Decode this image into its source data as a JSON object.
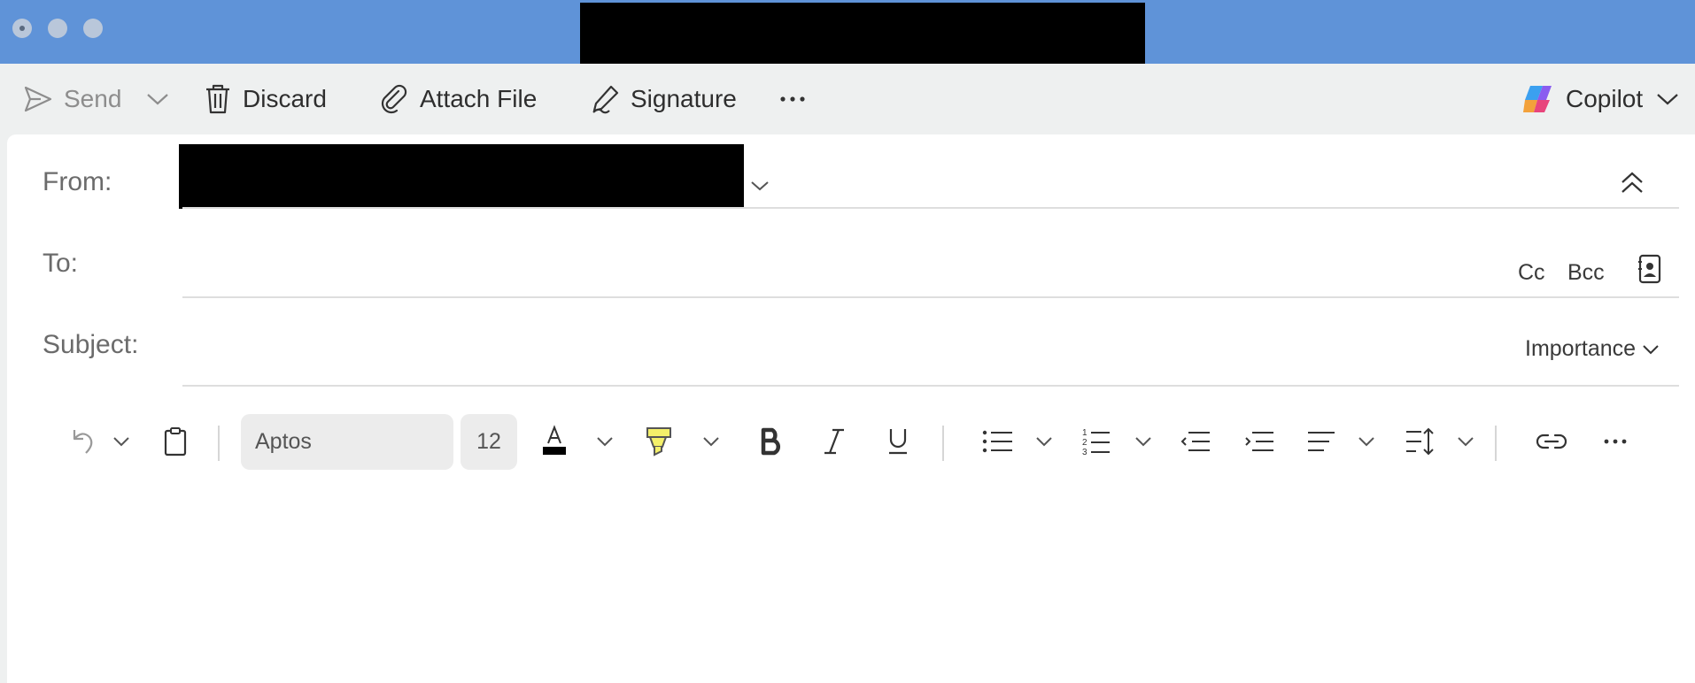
{
  "titlebar": {
    "controls": [
      "close",
      "minimize",
      "zoom"
    ]
  },
  "toolbar": {
    "send": "Send",
    "discard": "Discard",
    "attach_file": "Attach File",
    "signature": "Signature",
    "copilot": "Copilot"
  },
  "compose": {
    "from_label": "From:",
    "to_label": "To:",
    "cc": "Cc",
    "bcc": "Bcc",
    "subject_label": "Subject:",
    "importance": "Importance"
  },
  "format": {
    "font_name": "Aptos",
    "font_size": "12",
    "numbered_digits": [
      "1",
      "2",
      "3"
    ]
  },
  "colors": {
    "titlebar": "#5f93d8",
    "highlight_yellow": "#f4f06a",
    "font_color_bar": "#000000"
  }
}
